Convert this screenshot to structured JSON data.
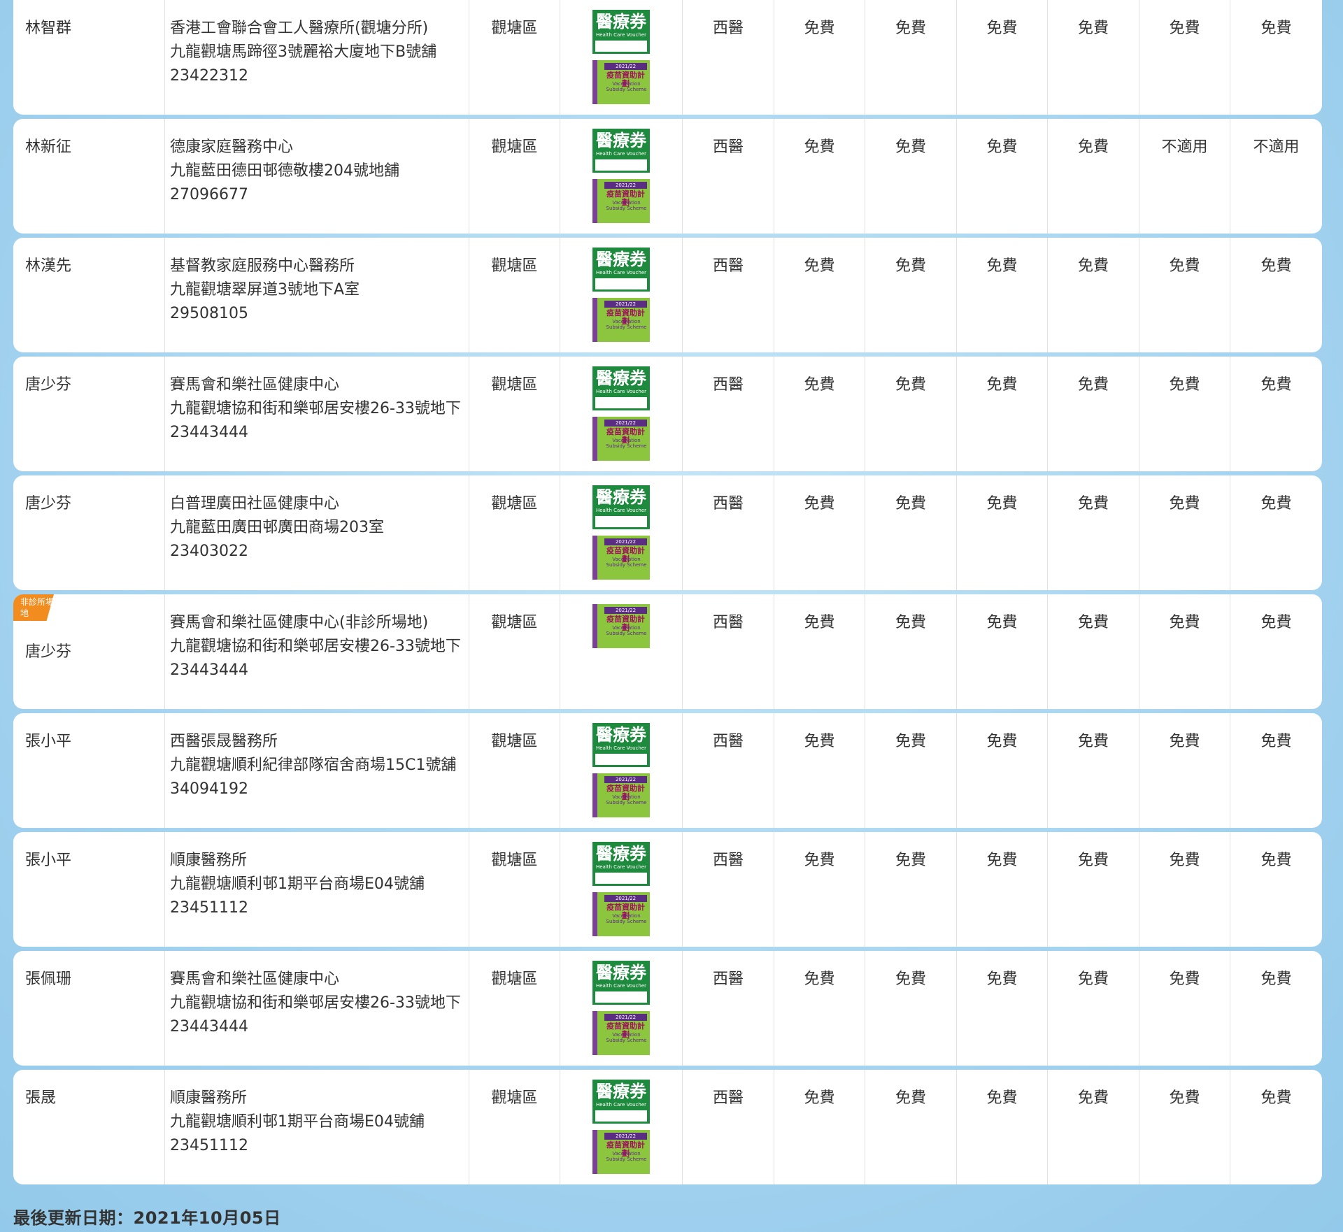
{
  "icons": {
    "hcv_title": "醫療券",
    "hcv_sub": "Health Care Voucher",
    "vss_year": "2021/22",
    "vss_title": "疫苗資助計劃",
    "vss_en": "Vaccination Subsidy Scheme"
  },
  "badge_label": "非診所場地",
  "rows": [
    {
      "doctor": "林智群",
      "clinic": "香港工會聯合會工人醫療所(觀塘分所)",
      "address": "九龍觀塘馬蹄徑3號麗裕大廈地下B號舖",
      "phone": "23422312",
      "district": "觀塘區",
      "type": "西醫",
      "f1": "免費",
      "f2": "免費",
      "f3": "免費",
      "f4": "免費",
      "f5": "免費",
      "f6": "免費"
    },
    {
      "doctor": "林新征",
      "clinic": "德康家庭醫務中心",
      "address": "九龍藍田德田邨德敬樓204號地舖",
      "phone": "27096677",
      "district": "觀塘區",
      "type": "西醫",
      "f1": "免費",
      "f2": "免費",
      "f3": "免費",
      "f4": "免費",
      "f5": "不適用",
      "f6": "不適用"
    },
    {
      "doctor": "林漢先",
      "clinic": "基督教家庭服務中心醫務所",
      "address": "九龍觀塘翠屏道3號地下A室",
      "phone": "29508105",
      "district": "觀塘區",
      "type": "西醫",
      "f1": "免費",
      "f2": "免費",
      "f3": "免費",
      "f4": "免費",
      "f5": "免費",
      "f6": "免費"
    },
    {
      "doctor": "唐少芬",
      "clinic": "賽馬會和樂社區健康中心",
      "address": "九龍觀塘協和街和樂邨居安樓26-33號地下",
      "phone": "23443444",
      "district": "觀塘區",
      "type": "西醫",
      "f1": "免費",
      "f2": "免費",
      "f3": "免費",
      "f4": "免費",
      "f5": "免費",
      "f6": "免費"
    },
    {
      "doctor": "唐少芬",
      "clinic": "白普理廣田社區健康中心",
      "address": "九龍藍田廣田邨廣田商場203室",
      "phone": "23403022",
      "district": "觀塘區",
      "type": "西醫",
      "f1": "免費",
      "f2": "免費",
      "f3": "免費",
      "f4": "免費",
      "f5": "免費",
      "f6": "免費"
    },
    {
      "doctor": "唐少芬",
      "clinic": "賽馬會和樂社區健康中心(非診所場地)",
      "address": "九龍觀塘協和街和樂邨居安樓26-33號地下",
      "phone": "23443444",
      "district": "觀塘區",
      "type": "西醫",
      "f1": "免費",
      "f2": "免費",
      "f3": "免費",
      "f4": "免費",
      "f5": "免費",
      "f6": "免費"
    },
    {
      "doctor": "張小平",
      "clinic": "西醫張晟醫務所",
      "address": "九龍觀塘順利紀律部隊宿舍商場15C1號舖",
      "phone": "34094192",
      "district": "觀塘區",
      "type": "西醫",
      "f1": "免費",
      "f2": "免費",
      "f3": "免費",
      "f4": "免費",
      "f5": "免費",
      "f6": "免費"
    },
    {
      "doctor": "張小平",
      "clinic": "順康醫務所",
      "address": "九龍觀塘順利邨1期平台商場E04號舖",
      "phone": "23451112",
      "district": "觀塘區",
      "type": "西醫",
      "f1": "免費",
      "f2": "免費",
      "f3": "免費",
      "f4": "免費",
      "f5": "免費",
      "f6": "免費"
    },
    {
      "doctor": "張佩珊",
      "clinic": "賽馬會和樂社區健康中心",
      "address": "九龍觀塘協和街和樂邨居安樓26-33號地下",
      "phone": "23443444",
      "district": "觀塘區",
      "type": "西醫",
      "f1": "免費",
      "f2": "免費",
      "f3": "免費",
      "f4": "免費",
      "f5": "免費",
      "f6": "免費"
    },
    {
      "doctor": "張晟",
      "clinic": "順康醫務所",
      "address": "九龍觀塘順利邨1期平台商場E04號舖",
      "phone": "23451112",
      "district": "觀塘區",
      "type": "西醫",
      "f1": "免費",
      "f2": "免費",
      "f3": "免費",
      "f4": "免費",
      "f5": "免費",
      "f6": "免費"
    }
  ],
  "footer": {
    "last_updated": "最後更新日期：2021年10月05日"
  }
}
